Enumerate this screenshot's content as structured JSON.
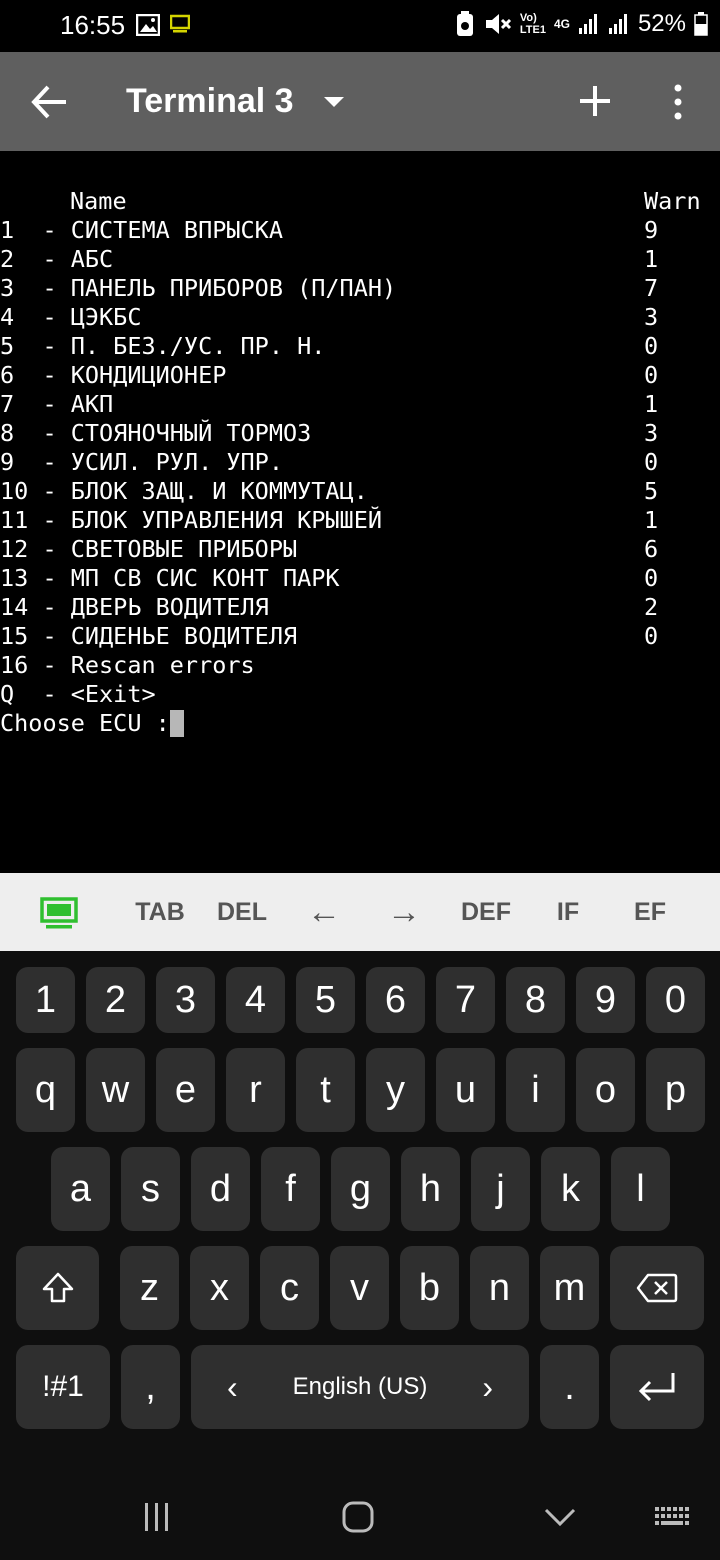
{
  "status_bar": {
    "time": "16:55",
    "battery": "52%",
    "signal_label_top": "Vo)",
    "signal_label_bottom": "LTE1",
    "network": "4G"
  },
  "app_bar": {
    "title": "Terminal 3"
  },
  "terminal": {
    "header_name": "Name",
    "header_warn": "Warn",
    "rows": [
      {
        "line": "1  - СИСТЕМА ВПРЫСКА",
        "warn": "9"
      },
      {
        "line": "2  - АБС",
        "warn": "1"
      },
      {
        "line": "3  - ПАНЕЛЬ ПРИБОРОВ (П/ПАН)",
        "warn": "7"
      },
      {
        "line": "4  - ЦЭКБС",
        "warn": "3"
      },
      {
        "line": "5  - П. БЕЗ./УС. ПР. Н.",
        "warn": "0"
      },
      {
        "line": "6  - КОНДИЦИОНЕР",
        "warn": "0"
      },
      {
        "line": "7  - АКП",
        "warn": "1"
      },
      {
        "line": "8  - СТОЯНОЧНЫЙ ТОРМОЗ",
        "warn": "3"
      },
      {
        "line": "9  - УСИЛ. РУЛ. УПР.",
        "warn": "0"
      },
      {
        "line": "10 - БЛОК ЗАЩ. И КОММУТАЦ.",
        "warn": "5"
      },
      {
        "line": "11 - БЛОК УПРАВЛЕНИЯ КРЫШЕЙ",
        "warn": "1"
      },
      {
        "line": "12 - СВЕТОВЫЕ ПРИБОРЫ",
        "warn": "6"
      },
      {
        "line": "13 - МП СВ СИС КОНТ ПАРК",
        "warn": "0"
      },
      {
        "line": "14 - ДВЕРЬ ВОДИТЕЛЯ",
        "warn": "2"
      },
      {
        "line": "15 - СИДЕНЬЕ ВОДИТЕЛЯ",
        "warn": "0"
      }
    ],
    "rescan": "16 - Rescan errors",
    "exit": "Q  - <Exit>",
    "prompt": "Choose ECU :"
  },
  "extra_keys": [
    "TAB",
    "DEL",
    "←",
    "→",
    "DEF",
    "IF",
    "EF"
  ],
  "keyboard": {
    "row_numbers": [
      "1",
      "2",
      "3",
      "4",
      "5",
      "6",
      "7",
      "8",
      "9",
      "0"
    ],
    "row_top": [
      "q",
      "w",
      "e",
      "r",
      "t",
      "y",
      "u",
      "i",
      "o",
      "p"
    ],
    "row_middle": [
      "a",
      "s",
      "d",
      "f",
      "g",
      "h",
      "j",
      "k",
      "l"
    ],
    "row_bottom": [
      "z",
      "x",
      "c",
      "v",
      "b",
      "n",
      "m"
    ],
    "symbols_key": "!#1",
    "comma_key": ",",
    "space_label": "English (US)",
    "period_key": ".",
    "space_left": "‹",
    "space_right": "›"
  },
  "colors": {
    "app_bar": "#5f5f5f",
    "extra_keys_bg": "#eeeeee",
    "keyboard_bg": "#0f0f0f",
    "key_bg": "#2f2f2f",
    "accent_green": "#2fbf2f"
  }
}
